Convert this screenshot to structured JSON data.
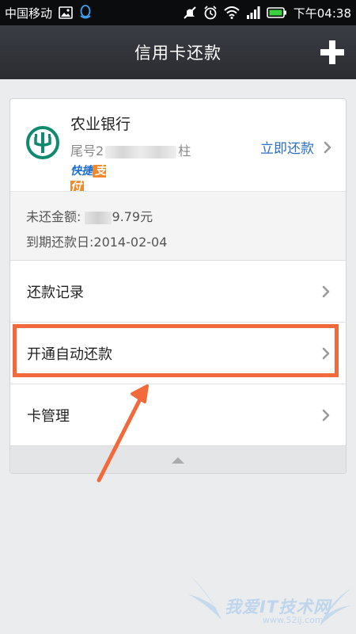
{
  "status_bar": {
    "carrier": "中国移动",
    "time": "下午04:38"
  },
  "header": {
    "title": "信用卡还款",
    "add_icon": "plus-icon"
  },
  "card": {
    "bank_name": "农业银行",
    "tail_prefix": "尾号2",
    "tail_suffix": "柱",
    "quickpay_a": "快捷",
    "quickpay_b": "支付",
    "pay_now_label": "立即还款",
    "unpaid_label": "未还金额: ",
    "unpaid_amount_suffix": "9.79元",
    "due_label": "到期还款日:2014-02-04"
  },
  "menu": [
    {
      "label": "还款记录"
    },
    {
      "label": "开通自动还款"
    },
    {
      "label": "卡管理"
    }
  ],
  "watermark": {
    "text": "我爱IT技术网",
    "sub": "www.52ij.com"
  },
  "colors": {
    "highlight": "#f26a3b",
    "link": "#2d6fbf",
    "header_bg": "#33363c"
  }
}
